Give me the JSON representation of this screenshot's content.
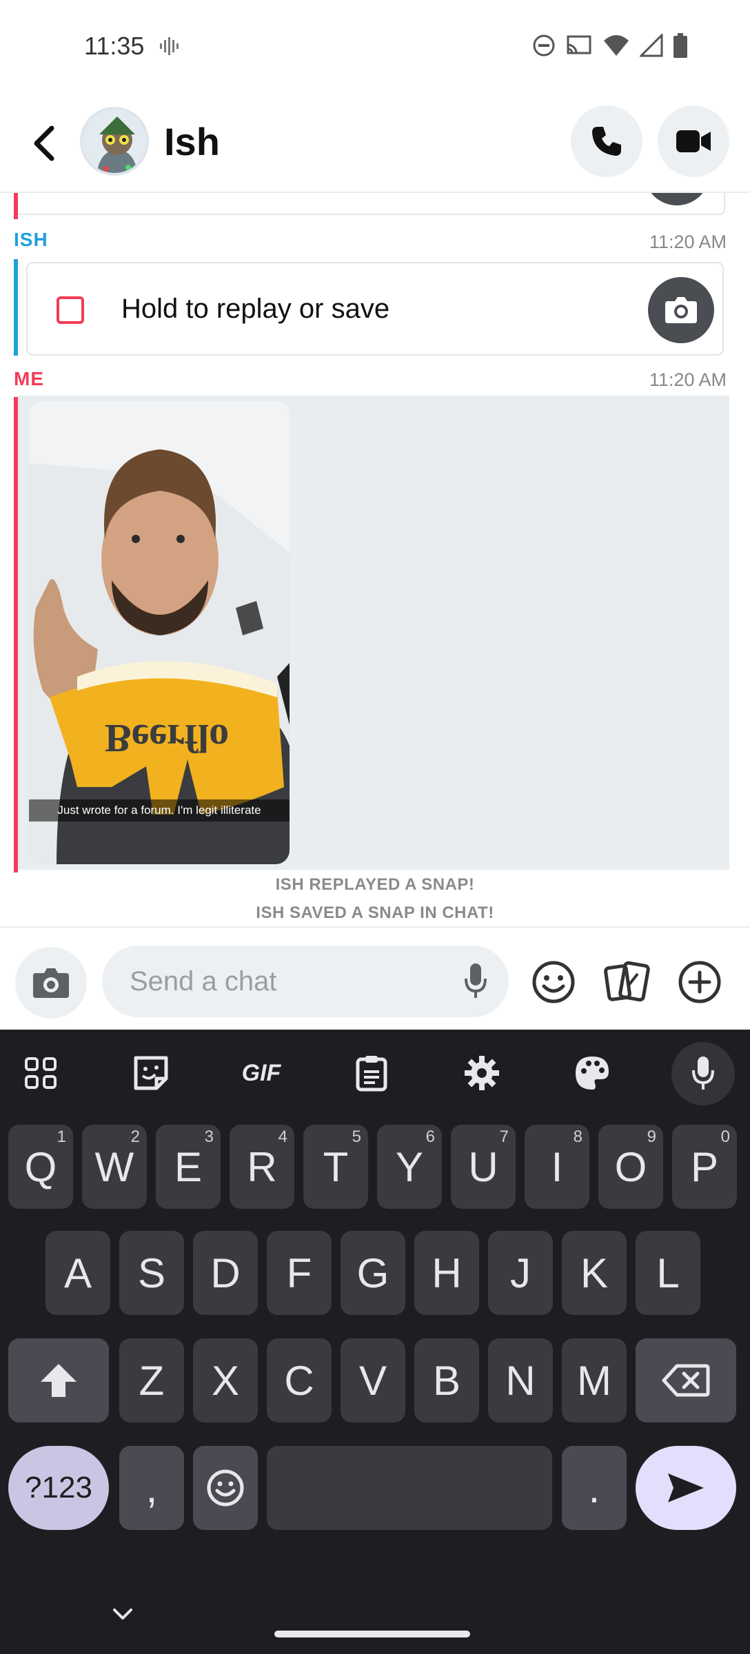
{
  "status_bar": {
    "time": "11:35",
    "icons": [
      "soundwave-icon",
      "do-not-disturb-icon",
      "cast-icon",
      "wifi-icon",
      "cell-signal-icon",
      "battery-icon"
    ]
  },
  "header": {
    "contact_name": "Ish",
    "icons": [
      "back-arrow-icon",
      "avatar",
      "phone-icon",
      "video-camera-icon"
    ]
  },
  "chat": {
    "messages": [
      {
        "sender": "ISH",
        "time": "11:20 AM",
        "text": "Hold to replay or save",
        "type": "snap"
      },
      {
        "sender": "ME",
        "time": "11:20 AM",
        "type": "photo",
        "caption": "Just wrote for a forum. I'm legit illiterate"
      }
    ],
    "system_messages": [
      "ISH REPLAYED A SNAP!",
      "ISH SAVED A SNAP IN CHAT!"
    ]
  },
  "compose": {
    "placeholder": "Send a chat",
    "icons": [
      "camera-icon",
      "microphone-icon",
      "smiley-icon",
      "cards-icon",
      "plus-icon"
    ]
  },
  "keyboard": {
    "toolbar": {
      "gif_label": "GIF"
    },
    "row1": [
      {
        "key": "Q",
        "hint": "1"
      },
      {
        "key": "W",
        "hint": "2"
      },
      {
        "key": "E",
        "hint": "3"
      },
      {
        "key": "R",
        "hint": "4"
      },
      {
        "key": "T",
        "hint": "5"
      },
      {
        "key": "Y",
        "hint": "6"
      },
      {
        "key": "U",
        "hint": "7"
      },
      {
        "key": "I",
        "hint": "8"
      },
      {
        "key": "O",
        "hint": "9"
      },
      {
        "key": "P",
        "hint": "0"
      }
    ],
    "row2": [
      "A",
      "S",
      "D",
      "F",
      "G",
      "H",
      "J",
      "K",
      "L"
    ],
    "row3": [
      "Z",
      "X",
      "C",
      "V",
      "B",
      "N",
      "M"
    ],
    "row4": {
      "symbols": "?123",
      "comma": ",",
      "period": "."
    }
  },
  "colors": {
    "accent_red": "#f23c57",
    "accent_blue": "#1fa0db",
    "keyboard_bg": "#1e1e22"
  }
}
